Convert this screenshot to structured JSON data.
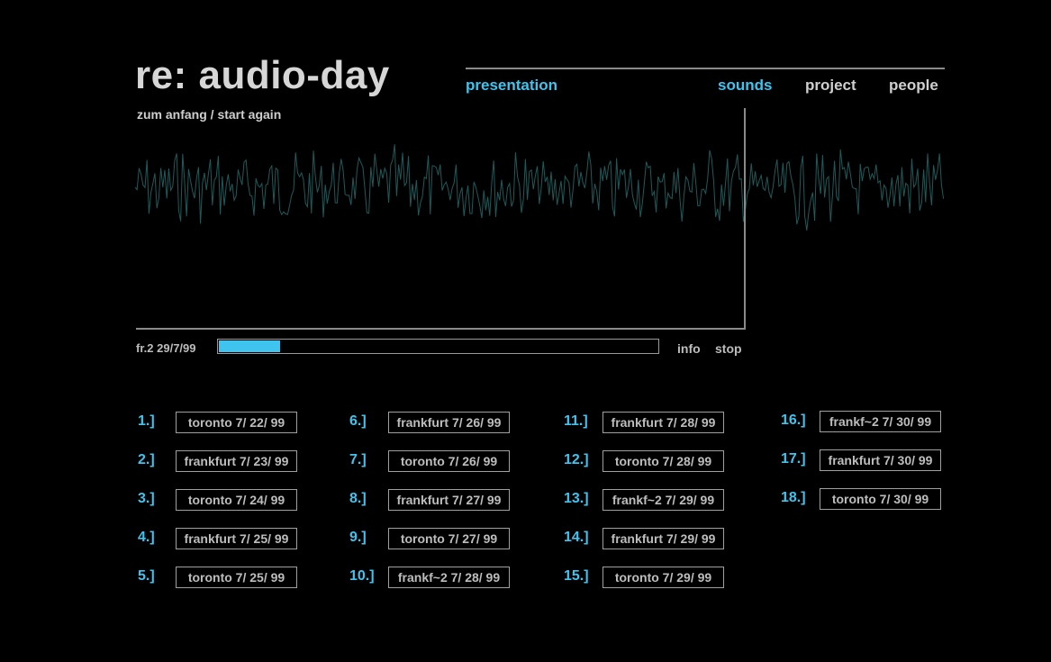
{
  "header": {
    "logo": "re: audio-day",
    "restart": "zum anfang / start again"
  },
  "nav": {
    "presentation": "presentation",
    "sounds": "sounds",
    "project": "project",
    "people": "people"
  },
  "player": {
    "current_track": "fr.2 29/7/99",
    "progress_percent": 14,
    "info_label": "info",
    "stop_label": "stop",
    "waveform_color": "#1f5a5a"
  },
  "colors": {
    "accent": "#3ec4ef",
    "background": "#000000",
    "text": "#bdbdbd"
  },
  "tracks": [
    {
      "num": "1.]",
      "label": "toronto 7/ 22/ 99"
    },
    {
      "num": "2.]",
      "label": "frankfurt 7/ 23/ 99"
    },
    {
      "num": "3.]",
      "label": "toronto 7/ 24/ 99"
    },
    {
      "num": "4.]",
      "label": "frankfurt 7/ 25/ 99"
    },
    {
      "num": "5.]",
      "label": "toronto 7/ 25/ 99"
    },
    {
      "num": "6.]",
      "label": "frankfurt 7/ 26/ 99"
    },
    {
      "num": "7.]",
      "label": "toronto 7/ 26/ 99"
    },
    {
      "num": "8.]",
      "label": "frankfurt 7/ 27/ 99"
    },
    {
      "num": "9.]",
      "label": "toronto 7/ 27/ 99"
    },
    {
      "num": "10.]",
      "label": "frankf~2  7/ 28/ 99"
    },
    {
      "num": "11.]",
      "label": "frankfurt 7/ 28/ 99"
    },
    {
      "num": "12.]",
      "label": "toronto 7/ 28/ 99"
    },
    {
      "num": "13.]",
      "label": "frankf~2  7/ 29/ 99"
    },
    {
      "num": "14.]",
      "label": "frankfurt 7/ 29/ 99"
    },
    {
      "num": "15.]",
      "label": "toronto 7/ 29/ 99"
    },
    {
      "num": "16.]",
      "label": "frankf~2  7/ 30/ 99"
    },
    {
      "num": "17.]",
      "label": "frankfurt 7/ 30/ 99"
    },
    {
      "num": "18.]",
      "label": "toronto 7/ 30/ 99"
    }
  ]
}
